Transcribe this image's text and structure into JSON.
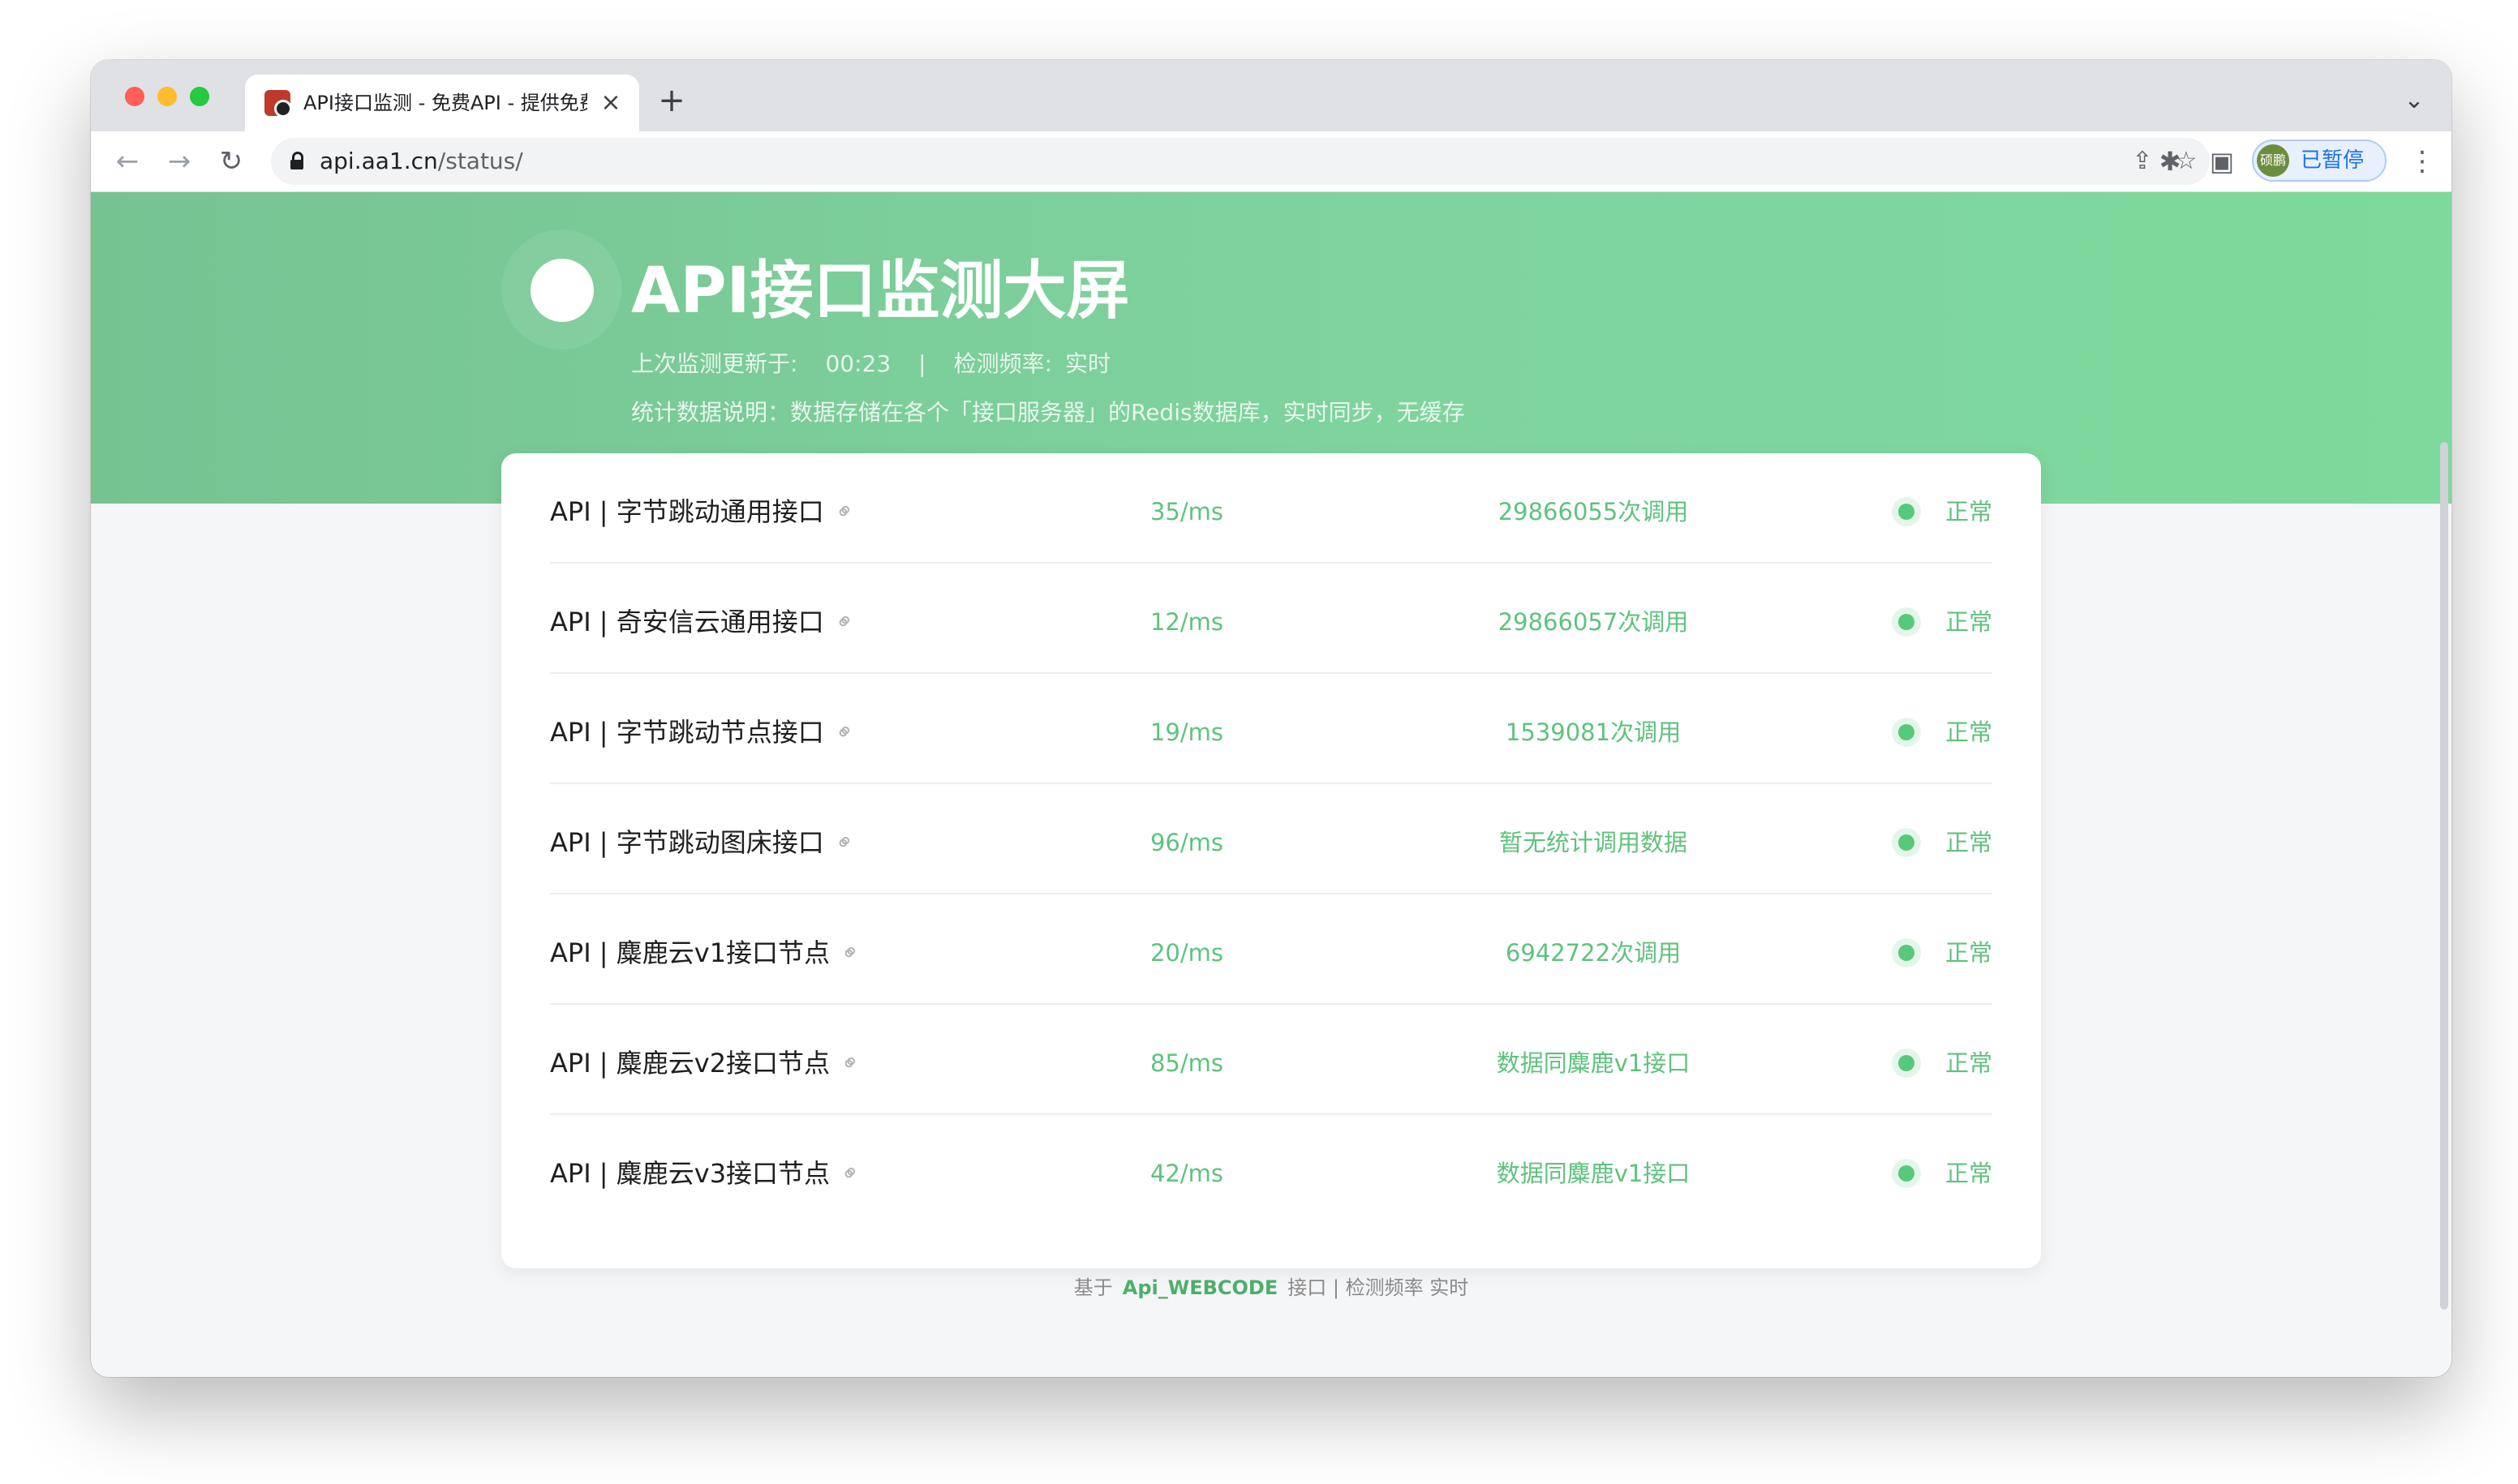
{
  "browser": {
    "tab_title": "API接口监测 - 免费API - 提供免费",
    "tab_close": "×",
    "new_tab": "+",
    "tab_list": "⌄",
    "url_host": "api.aa1.cn",
    "url_path": "/status/",
    "profile_avatar_text": "硕鹏",
    "profile_label": "已暂停",
    "icons": {
      "back": "←",
      "forward": "→",
      "reload": "↻",
      "share": "⇪",
      "star": "☆",
      "extensions": "✱",
      "sidepanel": "▣",
      "menu": "⋮"
    }
  },
  "page": {
    "title": "API接口监测大屏",
    "last_update_label": "上次监测更新于:",
    "last_update_time": "00:23",
    "separator": "|",
    "frequency_label": "检测频率:",
    "frequency_value": "实时",
    "description": "统计数据说明：数据存储在各个「接口服务器」的Redis数据库，实时同步，无缓存",
    "colors": {
      "accent_green": "#7dd39b",
      "status_green": "#57c97a",
      "text_green": "#5fc27e"
    }
  },
  "monitors": [
    {
      "name": "API | 字节跳动通用接口",
      "latency": "35/ms",
      "calls": "29866055次调用",
      "status": "正常"
    },
    {
      "name": "API | 奇安信云通用接口",
      "latency": "12/ms",
      "calls": "29866057次调用",
      "status": "正常"
    },
    {
      "name": "API | 字节跳动节点接口",
      "latency": "19/ms",
      "calls": "1539081次调用",
      "status": "正常"
    },
    {
      "name": "API | 字节跳动图床接口",
      "latency": "96/ms",
      "calls": "暂无统计调用数据",
      "status": "正常"
    },
    {
      "name": "API | 麋鹿云v1接口节点",
      "latency": "20/ms",
      "calls": "6942722次调用",
      "status": "正常"
    },
    {
      "name": "API | 麋鹿云v2接口节点",
      "latency": "85/ms",
      "calls": "数据同麋鹿v1接口",
      "status": "正常"
    },
    {
      "name": "API | 麋鹿云v3接口节点",
      "latency": "42/ms",
      "calls": "数据同麋鹿v1接口",
      "status": "正常"
    }
  ],
  "footer": {
    "prefix": "基于",
    "link": "Api_WEBCODE",
    "suffix": "接口 | 检测频率 实时"
  }
}
